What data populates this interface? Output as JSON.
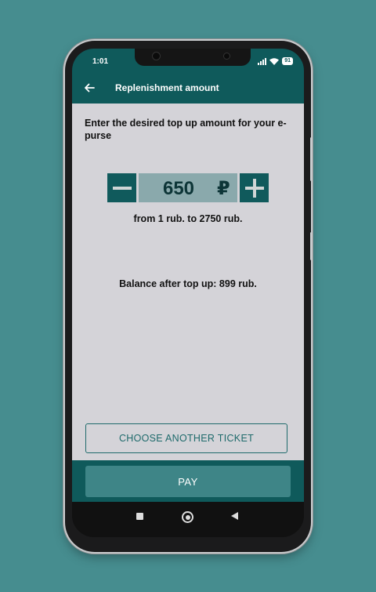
{
  "status_bar": {
    "time": "1:01",
    "battery": "91"
  },
  "app_bar": {
    "title": "Replenishment amount"
  },
  "content": {
    "instruction": "Enter the desired top up amount for your e-purse",
    "amount": "650",
    "currency_symbol": "₽",
    "range": "from 1 rub. to 2750 rub.",
    "balance": "Balance after top up: 899 rub."
  },
  "buttons": {
    "choose_another": "CHOOSE ANOTHER TICKET",
    "pay": "PAY"
  },
  "icons": {
    "back": "arrow-left-icon",
    "minus": "minus-icon",
    "plus": "plus-icon",
    "signal": "signal-icon",
    "wifi": "wifi-icon",
    "battery": "battery-icon"
  },
  "colors": {
    "background": "#468d8f",
    "primary": "#0f5a5b",
    "stepper_buttons": "#105a5c",
    "amount_box": "#8aa9ac",
    "content_bg": "#d4d3d8",
    "pay_button": "#3e8587"
  }
}
